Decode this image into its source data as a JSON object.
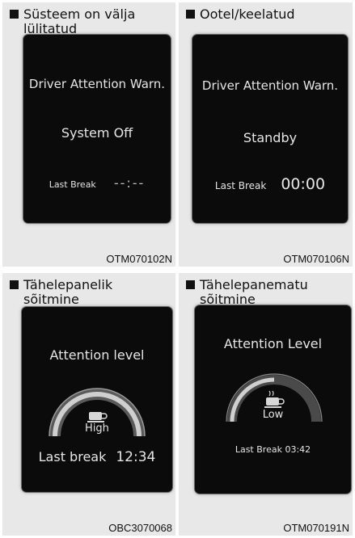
{
  "panels": [
    {
      "heading": "Süsteem on välja lülitatud",
      "screen": {
        "title": "Driver Attention Warn.",
        "status": "System Off",
        "last_break_label": "Last Break",
        "last_break_value": "--:--"
      },
      "code": "OTM070102N"
    },
    {
      "heading": "Ootel/keelatud",
      "screen": {
        "title": "Driver Attention Warn.",
        "status": "Standby",
        "last_break_label": "Last Break",
        "last_break_value": "00:00"
      },
      "code": "OTM070106N"
    },
    {
      "heading": "Tähelepanelik sõitmine",
      "screen": {
        "title": "Attention level",
        "level": "High",
        "last_break_label": "Last break",
        "last_break_value": "12:34"
      },
      "code": "OBC3070068"
    },
    {
      "heading": "Tähelepanematu sõitmine",
      "screen": {
        "title": "Attention Level",
        "level": "Low",
        "last_break_label": "Last Break",
        "last_break_value": "03:42"
      },
      "code": "OTM070191N"
    }
  ],
  "colors": {
    "panel_bg": "#e8e8e8",
    "screen_bg": "#0b0b0b",
    "screen_text": "#e6e6e6"
  }
}
